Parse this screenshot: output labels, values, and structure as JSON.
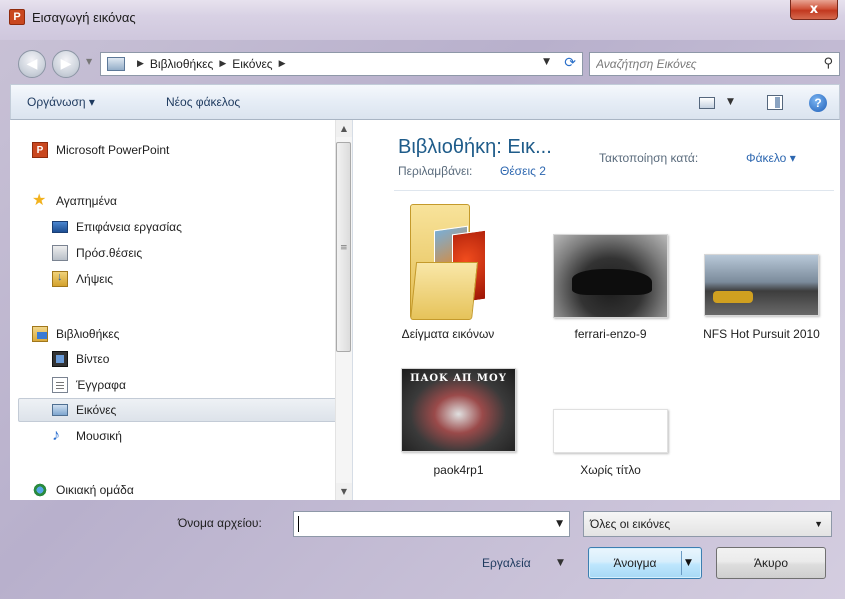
{
  "window": {
    "title": "Εισαγωγή εικόνας",
    "app_icon_letter": "P",
    "close_symbol": "x"
  },
  "address": {
    "crumbs": [
      "Βιβλιοθήκες",
      "Εικόνες"
    ],
    "search_placeholder": "Αναζήτηση Εικόνες"
  },
  "toolbar": {
    "organize_label": "Οργάνωση ▾",
    "new_folder_label": "Νέος φάκελος",
    "help_symbol": "?"
  },
  "nav": {
    "items": [
      {
        "label": "Microsoft PowerPoint",
        "icon": "powerpoint-icon"
      },
      {
        "label": "Αγαπημένα",
        "icon": "star-icon"
      },
      {
        "label": "Επιφάνεια εργασίας",
        "icon": "desktop-icon"
      },
      {
        "label": "Πρόσ.θέσεις",
        "icon": "recent-places-icon"
      },
      {
        "label": "Λήψεις",
        "icon": "downloads-icon"
      },
      {
        "label": "Βιβλιοθήκες",
        "icon": "libraries-icon"
      },
      {
        "label": "Βίντεο",
        "icon": "video-icon"
      },
      {
        "label": "Έγγραφα",
        "icon": "documents-icon"
      },
      {
        "label": "Εικόνες",
        "icon": "pictures-icon",
        "selected": true
      },
      {
        "label": "Μουσική",
        "icon": "music-icon"
      },
      {
        "label": "Οικιακή ομάδα",
        "icon": "homegroup-icon"
      }
    ]
  },
  "content": {
    "library_title": "Βιβλιοθήκη: Εικ...",
    "includes_label": "Περιλαμβάνει:",
    "includes_link": "Θέσεις 2",
    "arrange_label": "Τακτοποίηση κατά:",
    "arrange_value": "Φάκελο ▾",
    "items": [
      {
        "label": "Δείγματα εικόνων",
        "type": "folder"
      },
      {
        "label": "ferrari-enzo-9",
        "type": "image"
      },
      {
        "label": "NFS Hot Pursuit 2010",
        "type": "image"
      },
      {
        "label": "paok4rp1",
        "type": "image",
        "overlay_text": "ΠΑΟΚ ΑΠ ΜΟΥ"
      },
      {
        "label": "Χωρίς τίτλο",
        "type": "image"
      }
    ]
  },
  "footer": {
    "filename_label": "Όνομα αρχείου:",
    "filename_value": "",
    "filetype_value": "Όλες οι εικόνες",
    "tools_label": "Εργαλεία",
    "open_label": "Άνοιγμα",
    "cancel_label": "Άκυρο"
  }
}
